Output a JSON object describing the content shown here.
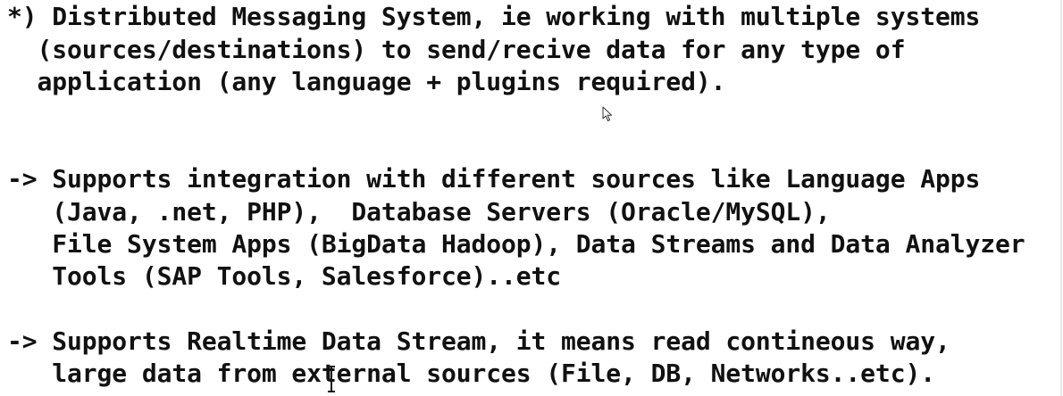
{
  "document": {
    "lines": [
      "*) Distributed Messaging System, ie working with multiple systems",
      "  (sources/destinations) to send/recive data for any type of",
      "  application (any language + plugins required).",
      "-> Supports integration with different sources like Language Apps",
      "   (Java, .net, PHP),  Database Servers (Oracle/MySQL),",
      "   File System Apps (BigData Hadoop), Data Streams and Data Analyzer",
      "   Tools (SAP Tools, Salesforce)..etc",
      "-> Supports Realtime Data Stream, it means read contineous way,",
      "   large data from external sources (File, DB, Networks..etc)."
    ]
  },
  "colors": {
    "text": "#111111",
    "background": "#ffffff"
  },
  "icons": {
    "text_cursor": "i-beam-cursor-icon",
    "mouse_pointer": "mouse-pointer-icon"
  }
}
